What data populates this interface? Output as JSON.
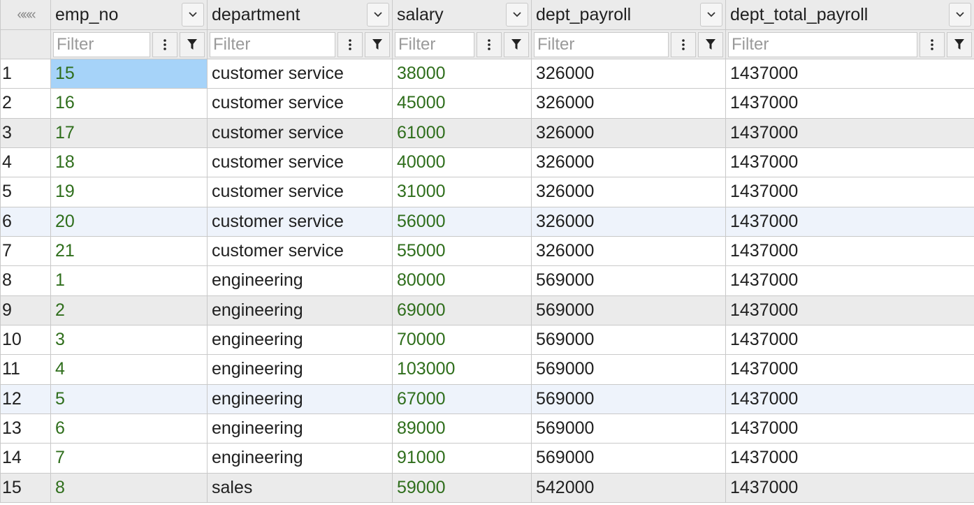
{
  "header": {
    "corner_glyph": "«««",
    "columns": [
      {
        "label": "emp_no",
        "key": "emp_no"
      },
      {
        "label": "department",
        "key": "department"
      },
      {
        "label": "salary",
        "key": "salary"
      },
      {
        "label": "dept_payroll",
        "key": "dept_payroll"
      },
      {
        "label": "dept_total_payroll",
        "key": "dept_total_payroll"
      }
    ]
  },
  "filters": {
    "placeholder": "Filter"
  },
  "colors": {
    "numeric_text": "#2f6e1c",
    "selected_cell": "#a6d3f9",
    "striped_row": "#ebebeb",
    "highlight_row": "#eef3fb"
  },
  "rows": [
    {
      "n": "1",
      "emp_no": "15",
      "department": "customer service",
      "salary": "38000",
      "dept_payroll": "326000",
      "dept_total_payroll": "1437000",
      "style": "plain",
      "selected_col": "emp_no"
    },
    {
      "n": "2",
      "emp_no": "16",
      "department": "customer service",
      "salary": "45000",
      "dept_payroll": "326000",
      "dept_total_payroll": "1437000",
      "style": "plain"
    },
    {
      "n": "3",
      "emp_no": "17",
      "department": "customer service",
      "salary": "61000",
      "dept_payroll": "326000",
      "dept_total_payroll": "1437000",
      "style": "alt"
    },
    {
      "n": "4",
      "emp_no": "18",
      "department": "customer service",
      "salary": "40000",
      "dept_payroll": "326000",
      "dept_total_payroll": "1437000",
      "style": "plain"
    },
    {
      "n": "5",
      "emp_no": "19",
      "department": "customer service",
      "salary": "31000",
      "dept_payroll": "326000",
      "dept_total_payroll": "1437000",
      "style": "plain"
    },
    {
      "n": "6",
      "emp_no": "20",
      "department": "customer service",
      "salary": "56000",
      "dept_payroll": "326000",
      "dept_total_payroll": "1437000",
      "style": "hl"
    },
    {
      "n": "7",
      "emp_no": "21",
      "department": "customer service",
      "salary": "55000",
      "dept_payroll": "326000",
      "dept_total_payroll": "1437000",
      "style": "plain"
    },
    {
      "n": "8",
      "emp_no": "1",
      "department": "engineering",
      "salary": "80000",
      "dept_payroll": "569000",
      "dept_total_payroll": "1437000",
      "style": "plain"
    },
    {
      "n": "9",
      "emp_no": "2",
      "department": "engineering",
      "salary": "69000",
      "dept_payroll": "569000",
      "dept_total_payroll": "1437000",
      "style": "alt"
    },
    {
      "n": "10",
      "emp_no": "3",
      "department": "engineering",
      "salary": "70000",
      "dept_payroll": "569000",
      "dept_total_payroll": "1437000",
      "style": "plain"
    },
    {
      "n": "11",
      "emp_no": "4",
      "department": "engineering",
      "salary": "103000",
      "dept_payroll": "569000",
      "dept_total_payroll": "1437000",
      "style": "plain"
    },
    {
      "n": "12",
      "emp_no": "5",
      "department": "engineering",
      "salary": "67000",
      "dept_payroll": "569000",
      "dept_total_payroll": "1437000",
      "style": "hl"
    },
    {
      "n": "13",
      "emp_no": "6",
      "department": "engineering",
      "salary": "89000",
      "dept_payroll": "569000",
      "dept_total_payroll": "1437000",
      "style": "plain"
    },
    {
      "n": "14",
      "emp_no": "7",
      "department": "engineering",
      "salary": "91000",
      "dept_payroll": "569000",
      "dept_total_payroll": "1437000",
      "style": "plain"
    },
    {
      "n": "15",
      "emp_no": "8",
      "department": "sales",
      "salary": "59000",
      "dept_payroll": "542000",
      "dept_total_payroll": "1437000",
      "style": "alt"
    }
  ]
}
